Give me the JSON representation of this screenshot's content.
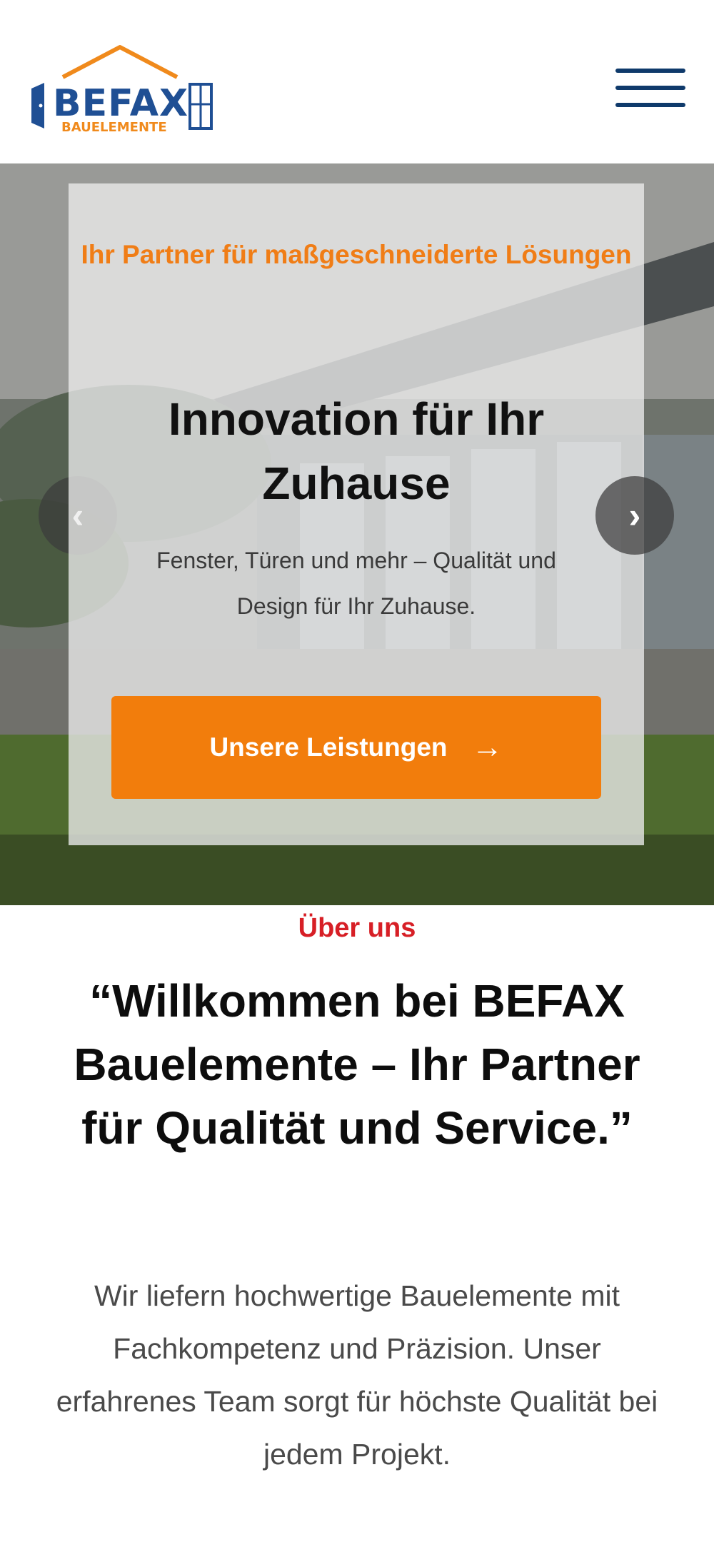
{
  "header": {
    "logo": {
      "brand": "BEFAX",
      "subline": "BAUELEMENTE"
    },
    "menu_icon": "hamburger-icon"
  },
  "hero": {
    "tagline": "Ihr Partner für maßgeschneiderte Lösungen",
    "title": "Innovation für Ihr Zuhause",
    "subtitle": "Fenster, Türen und mehr – Qualität und Design für Ihr Zuhause.",
    "cta_label": "Unsere Leistungen",
    "cta_icon": "arrow-right-icon",
    "prev_icon": "chevron-left-icon",
    "next_icon": "chevron-right-icon"
  },
  "about": {
    "label": "Über uns",
    "title": "“Willkommen bei BEFAX Bauelemente – Ihr Partner für Qualität und Service.”",
    "text": "Wir liefern hochwertige Bauelemente mit Fachkompetenz und Präzision. Unser erfahrenes Team sorgt für höchste Qualität bei jedem Projekt."
  },
  "colors": {
    "accent_orange": "#f27d0c",
    "brand_blue": "#1f4f94",
    "about_red": "#d71f26"
  }
}
